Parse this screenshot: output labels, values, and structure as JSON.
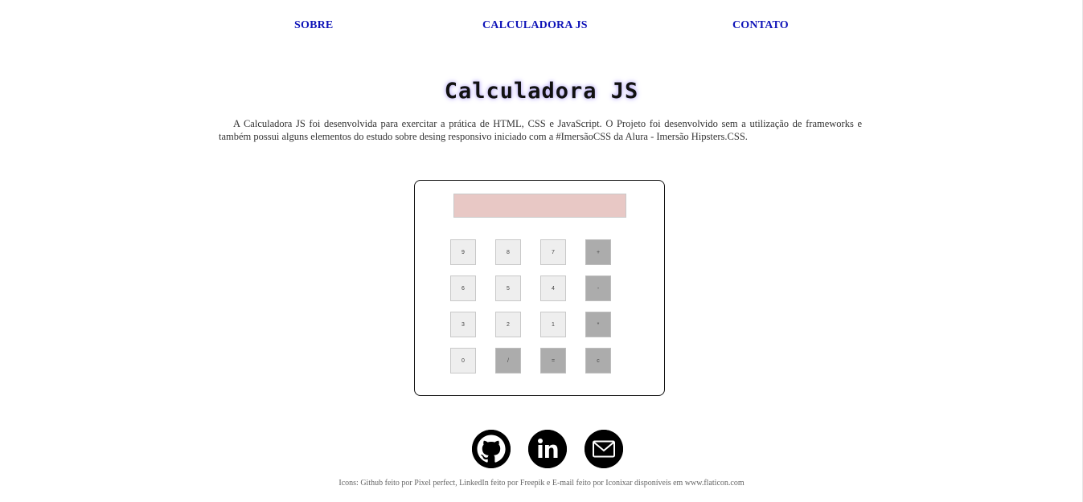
{
  "nav": {
    "sobre": "SOBRE",
    "calculadora": "CALCULADORA JS",
    "contato": "CONTATO"
  },
  "page": {
    "title": "Calculadora JS",
    "description": "A Calculadora JS foi desenvolvida para exercitar a prática de HTML, CSS e JavaScript. O Projeto foi desenvolvido sem a utilização de frameworks e também possui alguns elementos do estudo sobre desing responsivo iniciado com a #ImersãoCSS da Alura - Imersão Hipsters.CSS."
  },
  "calculator": {
    "display_value": "",
    "keys": [
      [
        "9",
        "8",
        "7",
        "+"
      ],
      [
        "6",
        "5",
        "4",
        "-"
      ],
      [
        "3",
        "2",
        "1",
        "*"
      ],
      [
        "0",
        "/",
        "=",
        "c"
      ]
    ],
    "colors": {
      "display": "#e8c8c5",
      "number_key": "#eeeeee",
      "operator_key": "#acacac"
    }
  },
  "social": {
    "github_icon": "github-icon",
    "linkedin_icon": "linkedin-icon",
    "email_icon": "email-icon"
  },
  "footer": {
    "credits": "Icons: Github feito por Pixel perfect, LinkedIn feito por Freepik e E-mail feito por Iconixar disponíveis em www.flaticon.com"
  },
  "colors": {
    "nav_link": "#0f14b8",
    "title_glow": "#b9aef0"
  }
}
